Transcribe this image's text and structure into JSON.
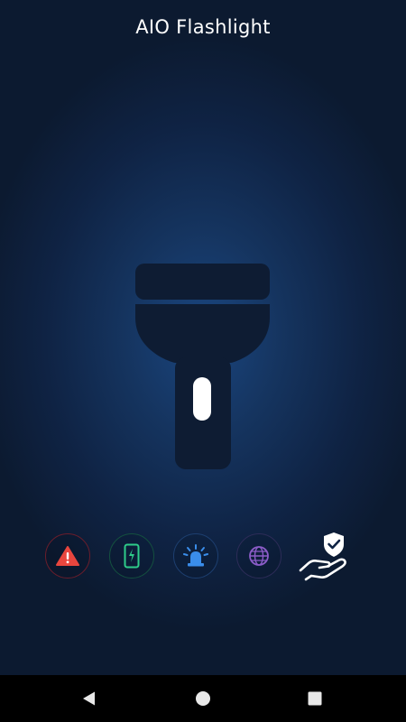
{
  "app": {
    "title": "AIO Flashlight"
  },
  "flashlight": {
    "state": "off",
    "switch_color": "#ffffff",
    "body_color": "#0e1c33"
  },
  "modes": [
    {
      "name": "sos",
      "icon": "warning-icon",
      "color": "#e8463e"
    },
    {
      "name": "screen-light",
      "icon": "phone-charging-icon",
      "color": "#2ecc8a"
    },
    {
      "name": "police-siren",
      "icon": "siren-icon",
      "color": "#3a8dea"
    },
    {
      "name": "disco",
      "icon": "globe-icon",
      "color": "#8b5cc8"
    }
  ],
  "privacy": {
    "icon": "hand-shield-check-icon",
    "color": "#ffffff"
  },
  "navbar": {
    "back_icon": "back-triangle-icon",
    "home_icon": "home-circle-icon",
    "recents_icon": "recents-square-icon",
    "icon_color": "#e8e8e8"
  }
}
